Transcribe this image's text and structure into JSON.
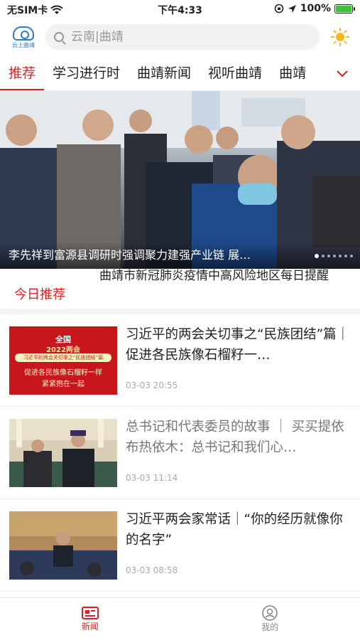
{
  "status": {
    "carrier": "无SIM卡",
    "time": "下午4:33",
    "battery": "100%"
  },
  "header": {
    "logo_text": "云上曲靖",
    "search_placeholder": "云南|曲靖"
  },
  "tabs": [
    "推荐",
    "学习进行时",
    "曲靖新闻",
    "视听曲靖",
    "曲靖"
  ],
  "banner": {
    "caption": "李先祥到富源县调研时强调聚力建强产业链 展…"
  },
  "today": {
    "label": "今日推荐",
    "headline": "曲靖市新冠肺炎疫情中高风险地区每日提醒"
  },
  "news": [
    {
      "title": "习近平的两会关切事之“民族团结”篇｜促进各民族像石榴籽一…",
      "time": "03-03 20:55",
      "read": false,
      "thumb": {
        "top": "全国",
        "year": "2022两会",
        "banner": "习近平的两会关切事之“民族团结”篇",
        "line1": "促进各民族像石榴籽一样",
        "line2": "紧紧抱在一起"
      }
    },
    {
      "title": "总书记和代表委员的故事 ｜ 买买提依布热依木：总书记和我们心…",
      "time": "03-03 11:14",
      "read": true
    },
    {
      "title": "习近平两会家常话｜“你的经历就像你的名字”",
      "time": "03-03 08:58",
      "read": false
    }
  ],
  "bottom_nav": [
    {
      "label": "新闻",
      "icon": "news-icon",
      "active": true
    },
    {
      "label": "我的",
      "icon": "profile-icon",
      "active": false
    }
  ],
  "colors": {
    "accent": "#e02020",
    "logo": "#2d79d6"
  }
}
